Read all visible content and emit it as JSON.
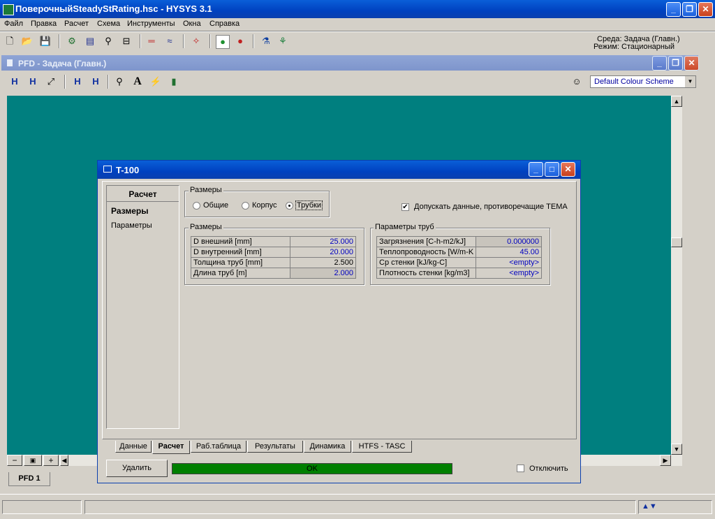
{
  "app": {
    "title": "ПоверочныйSteadyStRating.hsc - HYSYS 3.1"
  },
  "menu": [
    "Файл",
    "Правка",
    "Расчет",
    "Схема",
    "Инструменты",
    "Окна",
    "Справка"
  ],
  "status_right": {
    "env": "Среда: Задача (Главн.)",
    "mode": "Режим: Стационарный"
  },
  "pfd": {
    "title": "PFD - Задача (Главн.)",
    "colour_scheme": "Default Colour Scheme",
    "tab_label": "PFD 1"
  },
  "dialog": {
    "title": "T-100",
    "side_header": "Расчет",
    "side_items": [
      "Размеры",
      "Параметры"
    ],
    "sizes_group": {
      "label": "Размеры",
      "options": [
        "Общие",
        "Корпус",
        "Трубки"
      ],
      "selected": "Трубки"
    },
    "tema_checkbox": {
      "label": "Допускать данные, противоречащие TEMA",
      "checked": true
    },
    "dims": {
      "label": "Размеры",
      "rows": [
        {
          "name": "D внешний [mm]",
          "value": "25.000"
        },
        {
          "name": "D внутренний [mm]",
          "value": "20.000"
        },
        {
          "name": "Толщина труб [mm]",
          "value": "2.500"
        },
        {
          "name": "Длина труб [m]",
          "value": "2.000"
        }
      ]
    },
    "tube_params": {
      "label": "Параметры труб",
      "rows": [
        {
          "name": "Загрязнения [C-h-m2/kJ]",
          "value": "0.000000"
        },
        {
          "name": "Теплопроводность [W/m-K",
          "value": "45.00"
        },
        {
          "name": "Cp стенки [kJ/kg-C]",
          "value": "<empty>"
        },
        {
          "name": "Плотность стенки [kg/m3]",
          "value": "<empty>"
        }
      ]
    },
    "tabs": [
      "Данные",
      "Расчет",
      "Раб.таблица",
      "Результаты",
      "Динамика",
      "HTFS - TASC"
    ],
    "active_tab": "Расчет",
    "delete_button": "Удалить",
    "status": "OK",
    "status_color": "#007f00",
    "ignore_checkbox": {
      "label": "Отключить",
      "checked": false
    }
  }
}
